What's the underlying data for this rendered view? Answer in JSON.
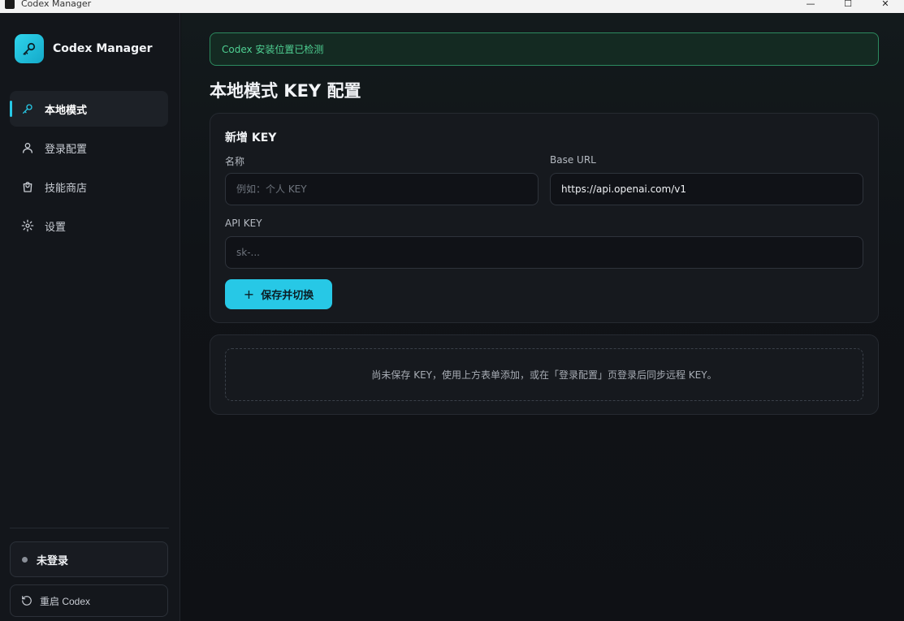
{
  "window": {
    "title": "Codex Manager",
    "controls": [
      "—",
      "☐",
      "✕"
    ]
  },
  "brand": {
    "name": "Codex Manager",
    "icon": "key-icon"
  },
  "sidebar": {
    "items": [
      {
        "label": "本地模式",
        "icon": "key-icon",
        "active": true
      },
      {
        "label": "登录配置",
        "icon": "user-icon",
        "active": false
      },
      {
        "label": "技能商店",
        "icon": "shopping-bag-icon",
        "active": false
      },
      {
        "label": "设置",
        "icon": "gear-icon",
        "active": false
      }
    ],
    "login_status": "未登录",
    "restart_label": "重启 Codex"
  },
  "alert": {
    "text": "Codex 安装位置已检测"
  },
  "page": {
    "title": "本地模式 KEY 配置"
  },
  "form": {
    "title": "新增 KEY",
    "name_label": "名称",
    "name_placeholder": "例如：个人 KEY",
    "base_url_label": "Base URL",
    "base_url_value": "https://api.openai.com/v1",
    "api_key_label": "API KEY",
    "api_key_placeholder": "sk-...",
    "save_label": "保存并切换"
  },
  "empty_state": {
    "text": "尚未保存 KEY，使用上方表单添加，或在「登录配置」页登录后同步远程 KEY。"
  },
  "colors": {
    "accent": "#27c8e6",
    "success": "#4fd193",
    "background": "#0f1115"
  }
}
